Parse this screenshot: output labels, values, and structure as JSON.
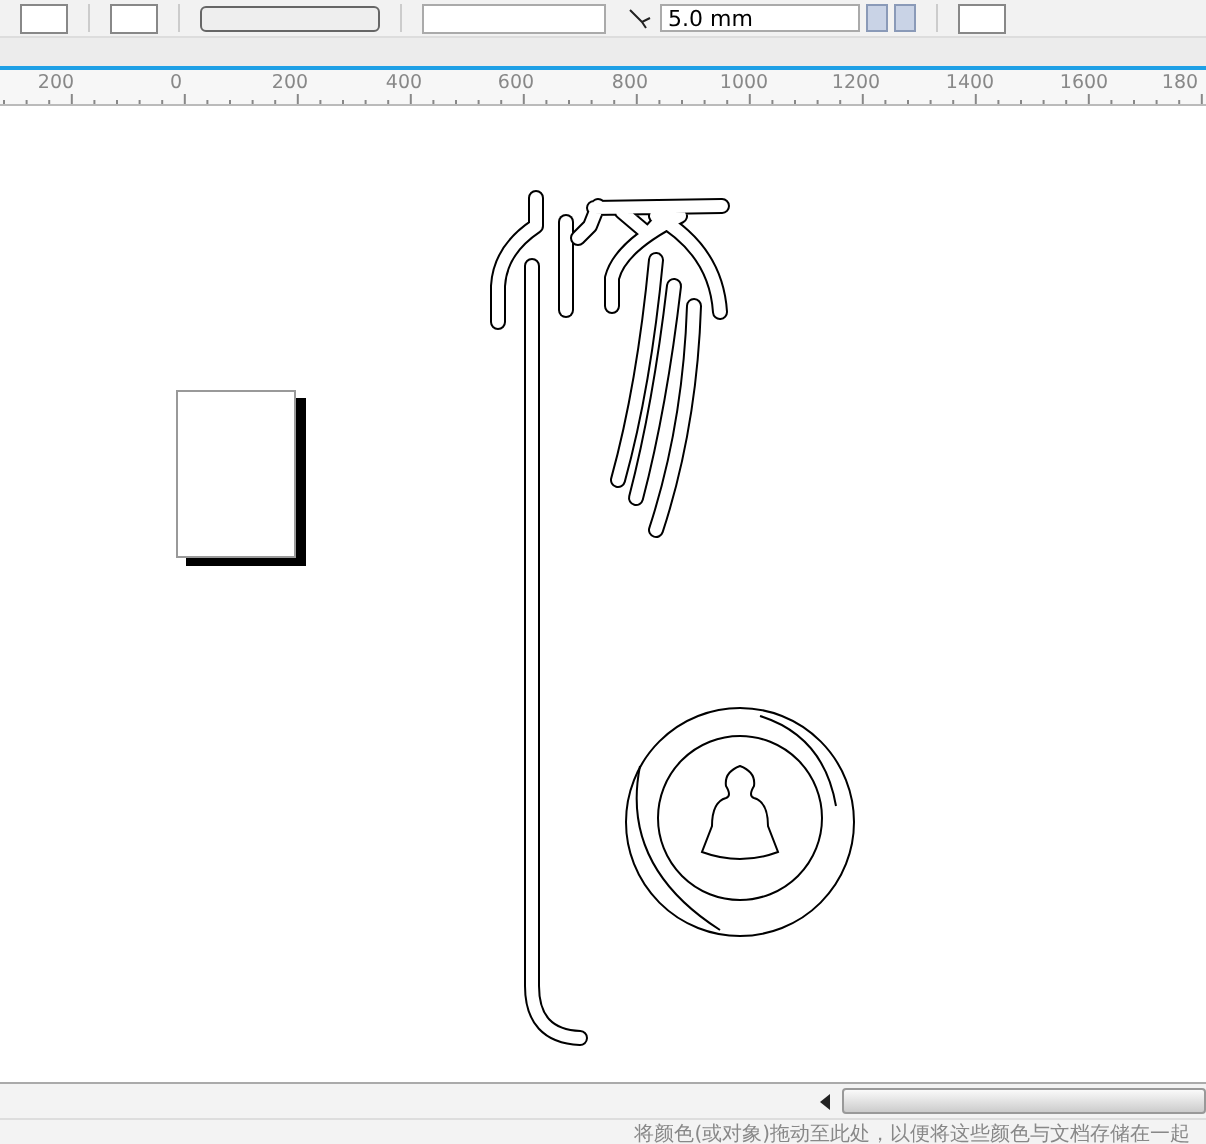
{
  "toolbar": {
    "outline_width": {
      "value": "5.0 mm"
    }
  },
  "ruler": {
    "labels": [
      "200",
      "0",
      "200",
      "400",
      "600",
      "800",
      "1000",
      "1200",
      "1400",
      "1600",
      "180"
    ]
  },
  "status_bar": {
    "hint": "将颜色(或对象)拖动至此处，以便将这些颜色与文档存储在一起"
  }
}
